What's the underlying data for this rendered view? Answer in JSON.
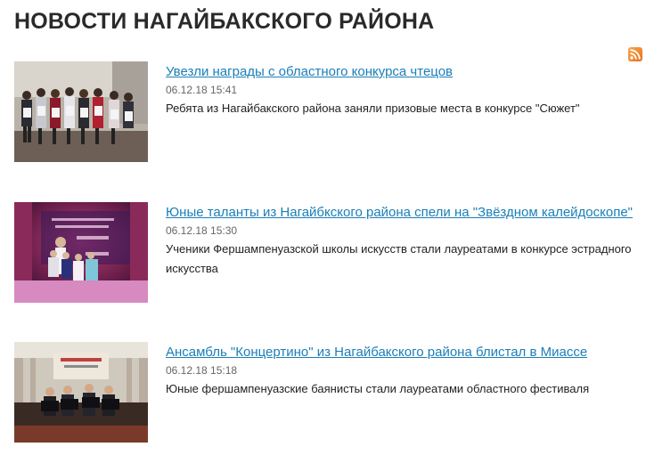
{
  "page": {
    "title": "НОВОСТИ НАГАЙБАКСКОГО РАЙОНА",
    "rss_icon": "rss-feed-icon"
  },
  "news": [
    {
      "title": "Увезли награды с областного конкурса чтецов",
      "date": "06.12.18 15:41",
      "summary": "Ребята из Нагайбакского района заняли призовые места в конкурсе \"Сюжет\"",
      "image": "children-with-diplomas-photo"
    },
    {
      "title": "Юные таланты из Нагайбкского района спели на \"Звёздном калейдоскопе\"",
      "date": "06.12.18 15:30",
      "summary": "Ученики Фершампенуазской школы искусств стали лауреатами в конкурсе эстрадного искусства",
      "image": "girls-on-stage-photo"
    },
    {
      "title": "Ансамбль \"Концертино\" из Нагайбакского района блистал в Миассе",
      "date": "06.12.18 15:18",
      "summary": "Юные фершампенуазские баянисты стали лауреатами областного фестиваля",
      "image": "accordion-ensemble-photo"
    }
  ],
  "colors": {
    "link": "#1a7fb8",
    "rss": "#e8731a",
    "title": "#2a2a2a"
  }
}
